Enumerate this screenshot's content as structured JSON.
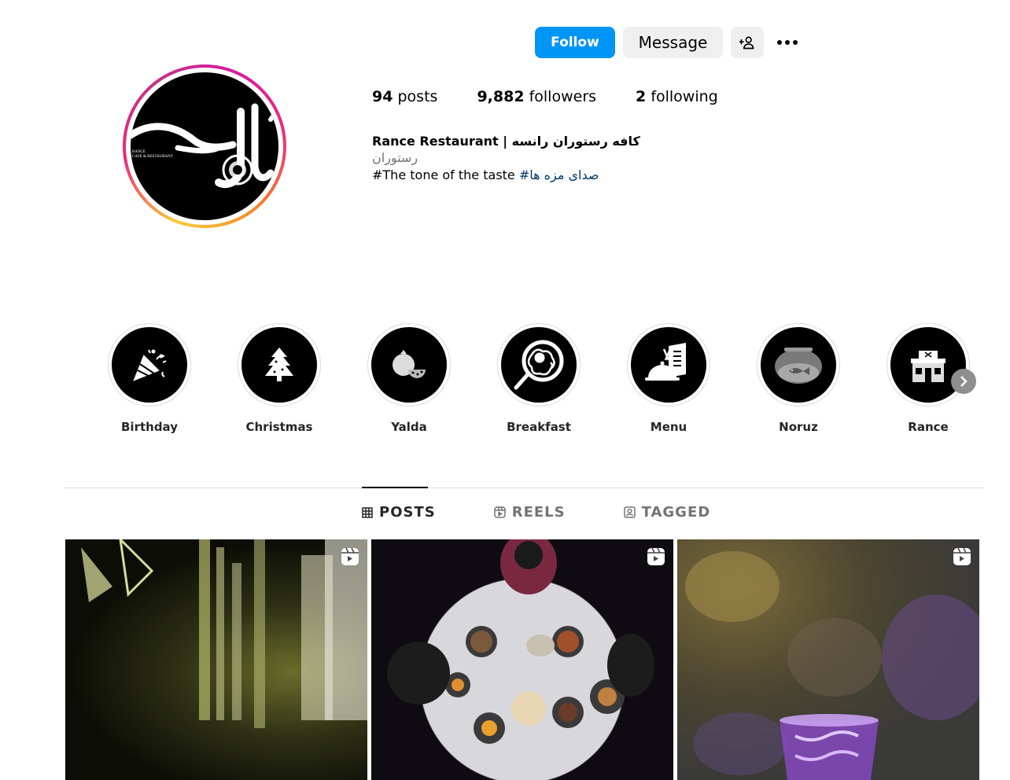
{
  "header": {
    "follow_label": "Follow",
    "message_label": "Message",
    "suggest_icon": "add-person-icon",
    "more_icon": "more-horizontal-icon"
  },
  "profile": {
    "avatar_text": "رانس",
    "avatar_subtext": "RANCE\nCAFE & RESTAURANT",
    "stats": {
      "posts_count": "94",
      "posts_label": "posts",
      "followers_count": "9,882",
      "followers_label": "followers",
      "following_count": "2",
      "following_label": "following"
    },
    "bio": {
      "name": "Rance Restaurant | کافه رستوران رانسه",
      "category": "رستوران",
      "line_text": "#The tone of the taste",
      "hashtag": "#صدای مزه ها"
    }
  },
  "highlights": [
    {
      "label": "Birthday",
      "icon": "party-popper-icon"
    },
    {
      "label": "Christmas",
      "icon": "christmas-tree-icon"
    },
    {
      "label": "Yalda",
      "icon": "pomegranate-icon"
    },
    {
      "label": "Breakfast",
      "icon": "frying-pan-egg-icon"
    },
    {
      "label": "Menu",
      "icon": "menu-cloche-icon"
    },
    {
      "label": "Noruz",
      "icon": "fishbowl-icon"
    },
    {
      "label": "Rance",
      "icon": "restaurant-building-icon"
    }
  ],
  "tabs": [
    {
      "label": "POSTS",
      "icon": "grid-icon",
      "active": true
    },
    {
      "label": "REELS",
      "icon": "reels-icon",
      "active": false
    },
    {
      "label": "TAGGED",
      "icon": "tagged-icon",
      "active": false
    }
  ],
  "posts": [
    {
      "type": "reel",
      "badge_icon": "reel-badge-icon"
    },
    {
      "type": "reel",
      "badge_icon": "reel-badge-icon"
    },
    {
      "type": "reel",
      "badge_icon": "reel-badge-icon"
    }
  ],
  "colors": {
    "follow_blue": "#0095f6",
    "button_gray": "#efefef",
    "hashtag_blue": "#00376b",
    "muted_text": "#737373"
  }
}
